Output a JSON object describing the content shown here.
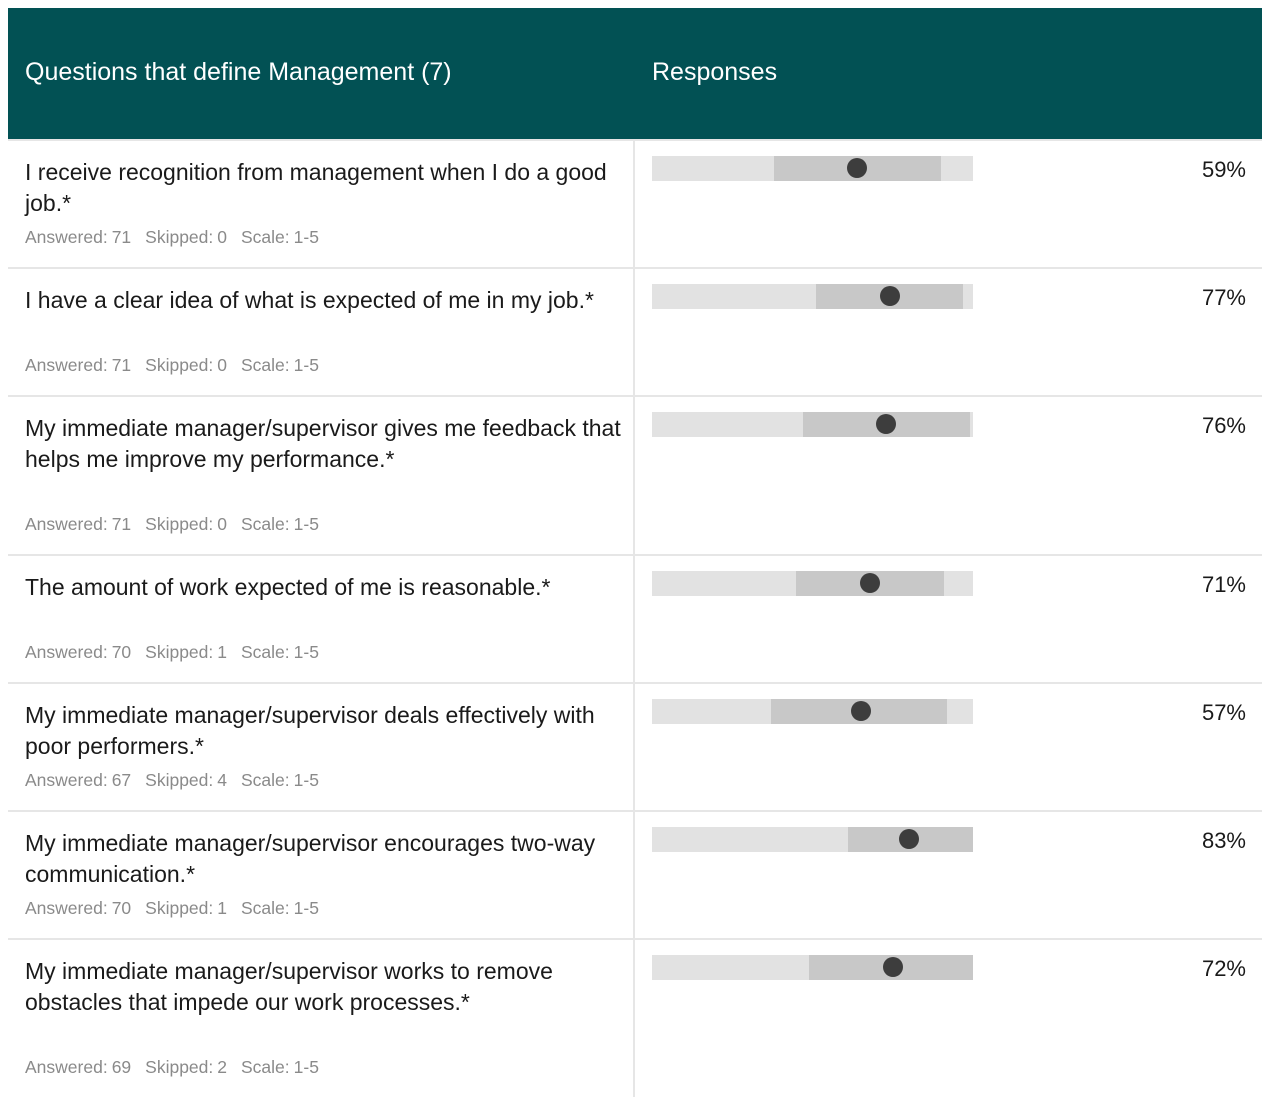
{
  "header": {
    "questions_label": "Questions that define Management (7)",
    "responses_label": "Responses"
  },
  "meta_labels": {
    "answered": "Answered:",
    "skipped": "Skipped:",
    "scale": "Scale:"
  },
  "rows": [
    {
      "question": "I receive recognition from management when I do a good job.*",
      "answered": "71",
      "skipped": "0",
      "scale": "1-5",
      "percent": "59%",
      "range_start": 0.38,
      "range_end": 0.9,
      "marker": 0.64
    },
    {
      "question": "I have a clear idea of what is expected of me in my job.*",
      "answered": "71",
      "skipped": "0",
      "scale": "1-5",
      "percent": "77%",
      "range_start": 0.51,
      "range_end": 0.97,
      "marker": 0.74
    },
    {
      "question": "My immediate manager/supervisor gives me feedback that helps me improve my performance.*",
      "answered": "71",
      "skipped": "0",
      "scale": "1-5",
      "percent": "76%",
      "range_start": 0.47,
      "range_end": 0.99,
      "marker": 0.73
    },
    {
      "question": "The amount of work expected of me is reasonable.*",
      "answered": "70",
      "skipped": "1",
      "scale": "1-5",
      "percent": "71%",
      "range_start": 0.45,
      "range_end": 0.91,
      "marker": 0.68
    },
    {
      "question": "My immediate manager/supervisor deals effectively with poor performers.*",
      "answered": "67",
      "skipped": "4",
      "scale": "1-5",
      "percent": "57%",
      "range_start": 0.37,
      "range_end": 0.92,
      "marker": 0.65
    },
    {
      "question": "My immediate manager/supervisor encourages two-way communication.*",
      "answered": "70",
      "skipped": "1",
      "scale": "1-5",
      "percent": "83%",
      "range_start": 0.61,
      "range_end": 1.0,
      "marker": 0.8
    },
    {
      "question": "My immediate manager/supervisor works to remove obstacles that impede our work processes.*",
      "answered": "69",
      "skipped": "2",
      "scale": "1-5",
      "percent": "72%",
      "range_start": 0.49,
      "range_end": 1.0,
      "marker": 0.75
    }
  ],
  "colors": {
    "header_bg": "#025154",
    "track": "#e2e2e2",
    "range": "#c8c8c8",
    "marker": "#3d3d3d"
  }
}
